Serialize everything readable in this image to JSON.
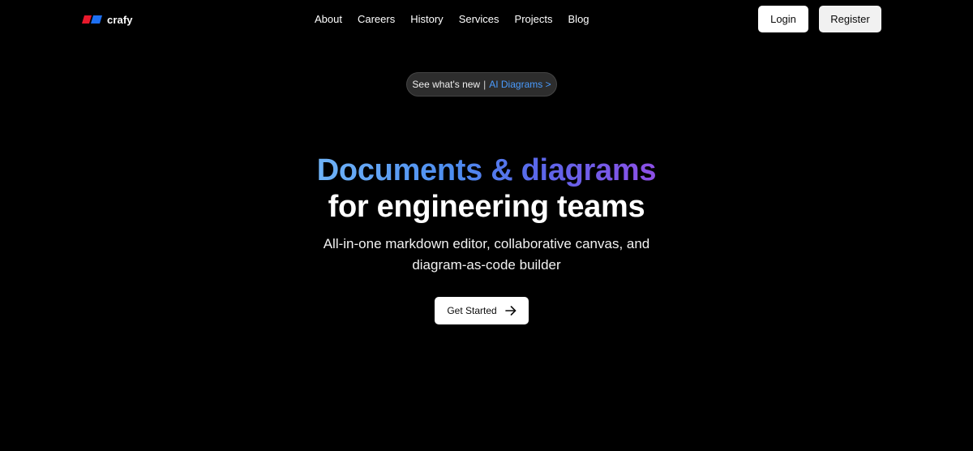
{
  "header": {
    "logo_text": "crafy",
    "nav": [
      {
        "label": "About"
      },
      {
        "label": "Careers"
      },
      {
        "label": "History"
      },
      {
        "label": "Services"
      },
      {
        "label": "Projects"
      },
      {
        "label": "Blog"
      }
    ],
    "login_label": "Login",
    "register_label": "Register"
  },
  "announcement": {
    "text": "See what's new",
    "separator": "|",
    "link_text": "AI Diagrams >"
  },
  "hero": {
    "title_gradient": "Documents & diagrams",
    "title_plain": "for engineering teams",
    "subtitle_line1": "All-in-one markdown editor, collaborative canvas, and",
    "subtitle_line2": "diagram-as-code builder",
    "cta_label": "Get Started"
  },
  "colors": {
    "background": "#000000",
    "logo_red": "#e8192c",
    "logo_blue": "#1d6ff2",
    "link_blue": "#4a9cff",
    "gradient_start": "#6fb3f7",
    "gradient_end": "#8d4fe6"
  },
  "icons": {
    "logo": "crafy-logo-icon",
    "cta_arrow": "arrow-right-icon"
  }
}
